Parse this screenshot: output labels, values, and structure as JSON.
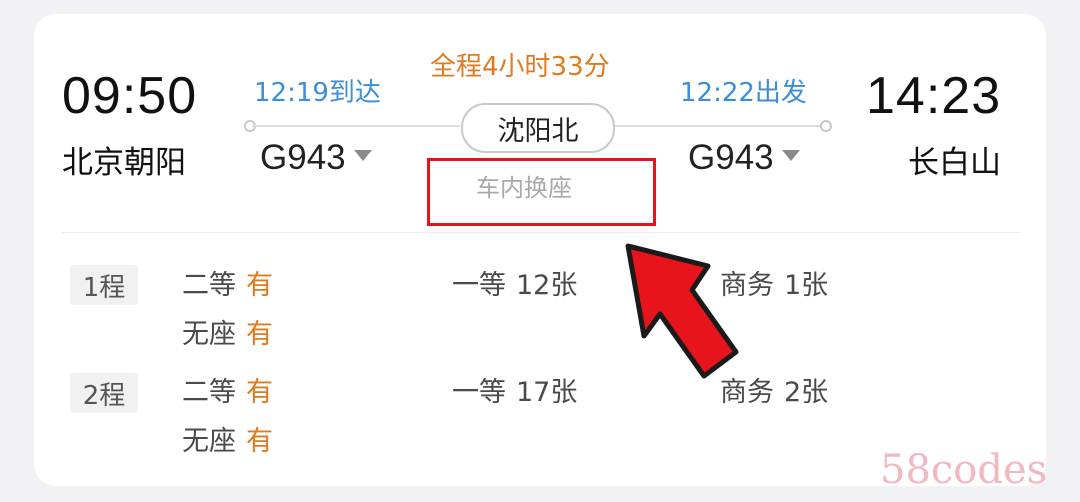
{
  "trip": {
    "depart_time": "09:50",
    "depart_station": "北京朝阳",
    "arrive_time": "14:23",
    "arrive_station": "长白山",
    "duration": "全程4小时33分",
    "transfer_arrive": "12:19到达",
    "transfer_depart": "12:22出发",
    "transfer_station": "沈阳北",
    "transfer_note": "车内换座",
    "train_1": "G943",
    "train_2": "G943"
  },
  "legs": [
    {
      "badge": "1程",
      "seats": [
        {
          "class": "二等",
          "availability": "有"
        },
        {
          "class": "一等",
          "availability": "12张"
        },
        {
          "class": "商务",
          "availability": "1张"
        },
        {
          "class": "无座",
          "availability": "有"
        }
      ]
    },
    {
      "badge": "2程",
      "seats": [
        {
          "class": "二等",
          "availability": "有"
        },
        {
          "class": "一等",
          "availability": "17张"
        },
        {
          "class": "商务",
          "availability": "2张"
        },
        {
          "class": "无座",
          "availability": "有"
        }
      ]
    }
  ],
  "watermark": "58codes",
  "colors": {
    "accent_blue": "#3d8ed8",
    "accent_orange": "#e07a1c",
    "highlight_red": "#e3141c"
  },
  "icons": {
    "caret": "caret-down-icon",
    "annotation": "red-arrow-icon"
  }
}
